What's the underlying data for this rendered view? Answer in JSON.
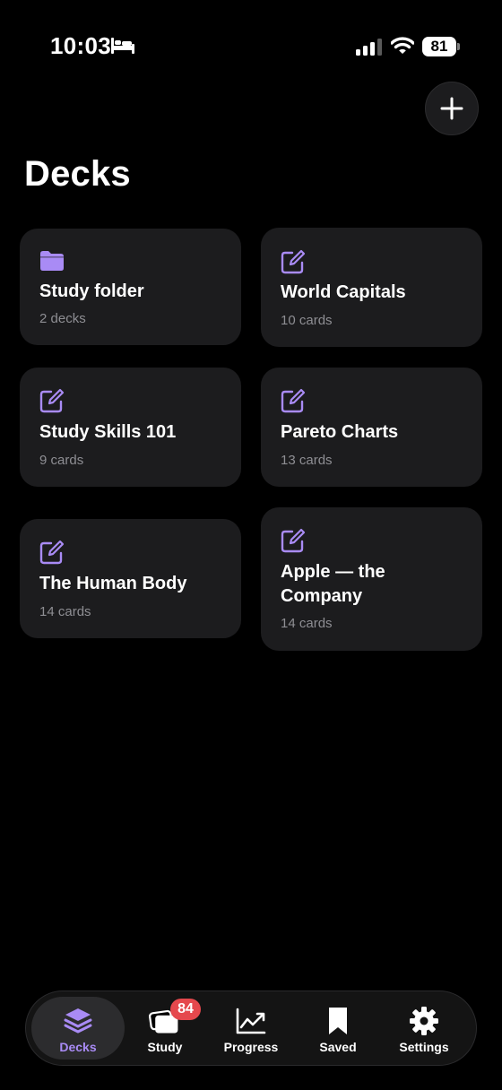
{
  "status_bar": {
    "time": "10:03",
    "battery": "81"
  },
  "header": {
    "title": "Decks",
    "add_icon": "plus-icon"
  },
  "decks": [
    {
      "name": "Study folder",
      "count": "2 decks",
      "icon": "folder-icon"
    },
    {
      "name": "World Capitals",
      "count": "10 cards",
      "icon": "edit-icon"
    },
    {
      "name": "Study Skills 101",
      "count": "9 cards",
      "icon": "edit-icon"
    },
    {
      "name": "Pareto Charts",
      "count": "13 cards",
      "icon": "edit-icon"
    },
    {
      "name": "The Human Body",
      "count": "14 cards",
      "icon": "edit-icon"
    },
    {
      "name": "Apple — the Company",
      "count": "14 cards",
      "icon": "edit-icon"
    }
  ],
  "tabs": [
    {
      "label": "Decks",
      "icon": "stack-icon",
      "active": true
    },
    {
      "label": "Study",
      "icon": "cards-icon",
      "badge": "84"
    },
    {
      "label": "Progress",
      "icon": "chart-icon"
    },
    {
      "label": "Saved",
      "icon": "bookmark-icon"
    },
    {
      "label": "Settings",
      "icon": "gear-icon"
    }
  ],
  "colors": {
    "accent": "#a98bf5",
    "card_bg": "#1c1c1e",
    "badge": "#e5484d"
  }
}
